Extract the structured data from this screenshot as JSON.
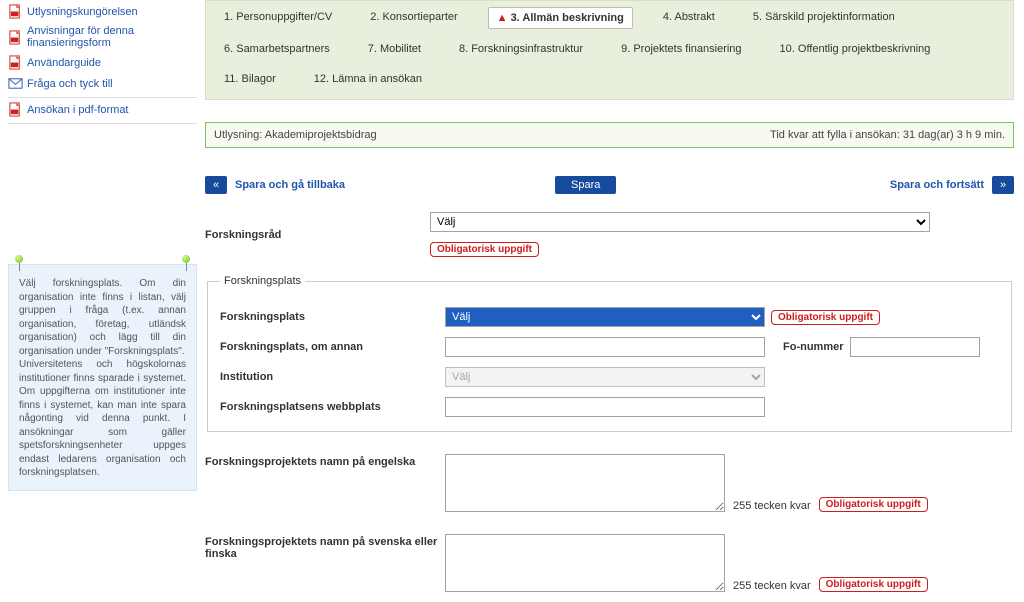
{
  "sidebar": {
    "links": [
      {
        "label": "Utlysningskungörelsen",
        "icon": "pdf"
      },
      {
        "label": "Anvisningar för denna finansieringsform",
        "icon": "pdf"
      },
      {
        "label": "Användarguide",
        "icon": "pdf"
      },
      {
        "label": "Fråga och tyck till",
        "icon": "mail"
      },
      {
        "label": "Ansökan i pdf-format",
        "icon": "pdf"
      }
    ],
    "help_text": "Välj forskningsplats. Om din organisation inte finns i listan, välj gruppen i fråga (t.ex. annan organisation, företag, utländsk organisation) och lägg till din organisation under \"Forskningsplats\".\nUniversitetens och högskolornas institutioner finns sparade i systemet. Om uppgifterna om institutioner inte finns i systemet, kan man inte spara någonting vid denna punkt. I ansökningar som gäller spetsforskningsenheter uppges endast ledarens organisation och forskningsplatsen."
  },
  "tabs": [
    {
      "label": "1. Personuppgifter/CV"
    },
    {
      "label": "2. Konsortieparter"
    },
    {
      "label": "3. Allmän beskrivning",
      "active": true,
      "warn": true
    },
    {
      "label": "4. Abstrakt"
    },
    {
      "label": "5. Särskild projektinformation"
    },
    {
      "label": "6. Samarbetspartners"
    },
    {
      "label": "7. Mobilitet"
    },
    {
      "label": "8. Forskningsinfrastruktur"
    },
    {
      "label": "9. Projektets finansiering"
    },
    {
      "label": "10. Offentlig projektbeskrivning"
    },
    {
      "label": "11. Bilagor"
    },
    {
      "label": "12. Lämna in ansökan"
    }
  ],
  "notice": {
    "left": "Utlysning: Akademiprojektsbidrag",
    "right": "Tid kvar att fylla i ansökan: 31 dag(ar) 3 h 9 min."
  },
  "buttons": {
    "back": "Spara och gå tillbaka",
    "save": "Spara",
    "forward": "Spara och fortsätt",
    "prev_sym": "«",
    "next_sym": "»"
  },
  "form": {
    "council_label": "Forskningsråd",
    "council_placeholder": "Välj",
    "req_badge": "Obligatorisk uppgift",
    "place_legend": "Forskningsplats",
    "place_label": "Forskningsplats",
    "place_placeholder": "Välj",
    "place_other_label": "Forskningsplats, om annan",
    "fo_label": "Fo-nummer",
    "inst_label": "Institution",
    "inst_placeholder": "Välj",
    "web_label": "Forskningsplatsens webbplats",
    "name_en_label": "Forskningsprojektets namn på engelska",
    "name_sv_label": "Forskningsprojektets namn på svenska eller finska",
    "chars_left": "255 tecken kvar"
  }
}
